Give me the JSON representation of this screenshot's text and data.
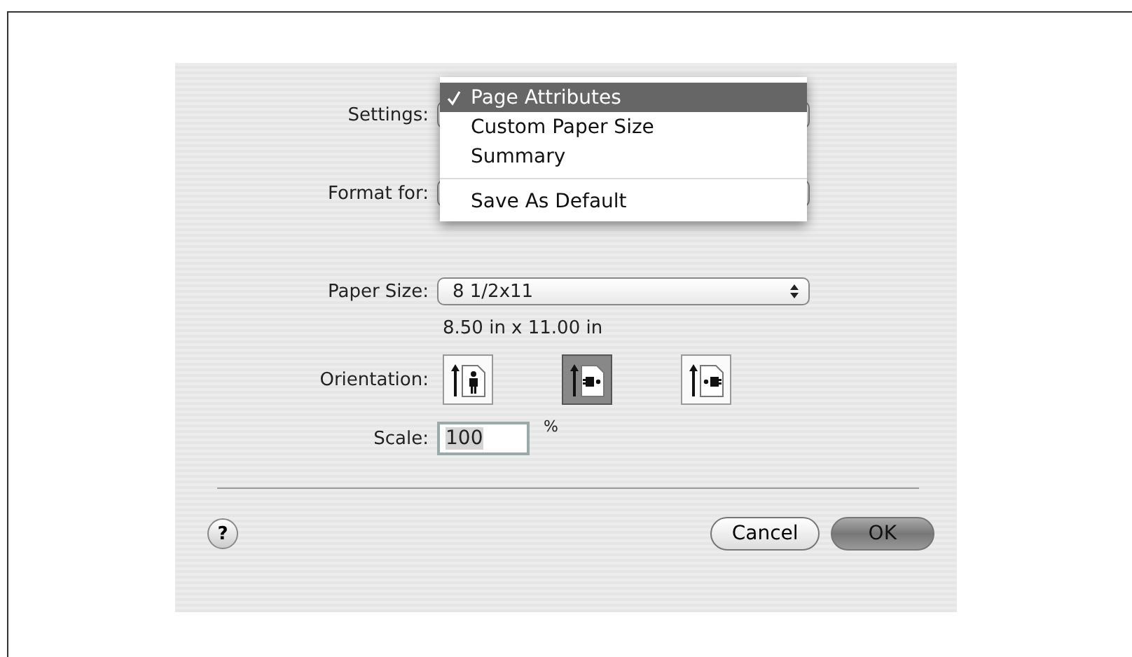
{
  "dialog": {
    "settings": {
      "label": "Settings:",
      "menu": [
        {
          "label": "Page Attributes",
          "selected": true,
          "separator_before": false
        },
        {
          "label": "Custom Paper Size",
          "selected": false,
          "separator_before": false
        },
        {
          "label": "Summary",
          "selected": false,
          "separator_before": false
        },
        {
          "label": "Save As Default",
          "selected": false,
          "separator_before": true
        }
      ]
    },
    "format_for": {
      "label": "Format for:"
    },
    "paper_size": {
      "label": "Paper Size:",
      "value": "8 1/2x11",
      "dimensions": "8.50 in x 11.00 in"
    },
    "orientation": {
      "label": "Orientation:",
      "options": [
        {
          "kind": "portrait",
          "selected": false
        },
        {
          "kind": "landscape",
          "selected": true
        },
        {
          "kind": "reverse-landscape",
          "selected": false
        }
      ]
    },
    "scale": {
      "label": "Scale:",
      "value": "100",
      "unit": "%"
    },
    "help": "?",
    "buttons": [
      {
        "label": "Cancel",
        "default": false
      },
      {
        "label": "OK",
        "default": true
      }
    ]
  }
}
